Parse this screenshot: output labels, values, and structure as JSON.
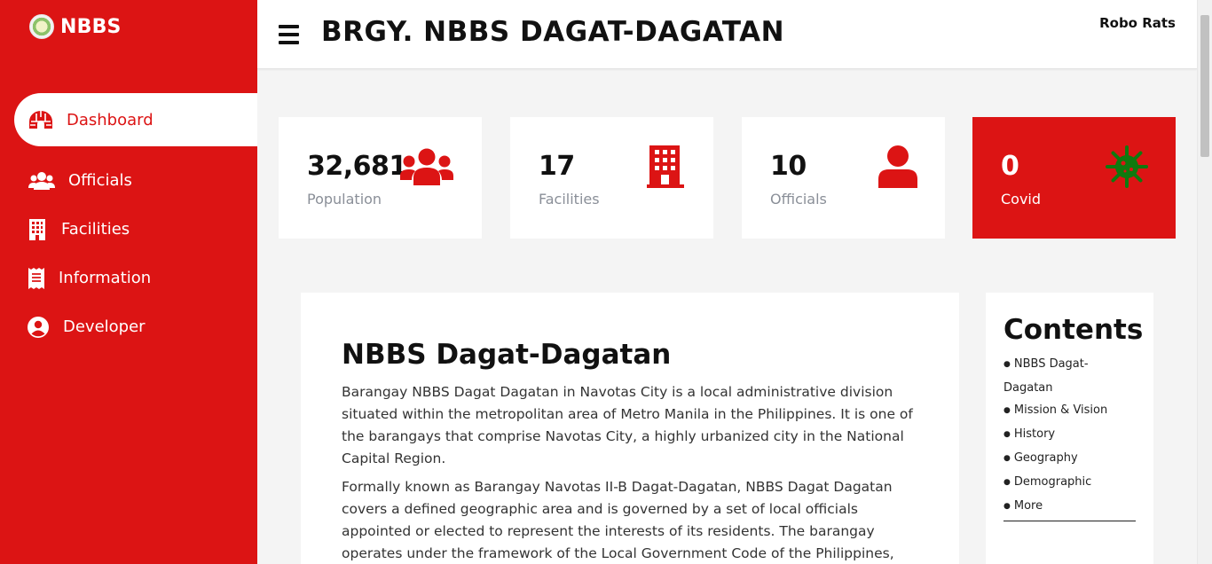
{
  "sidebar": {
    "brand": "NBBS",
    "items": [
      {
        "label": "Dashboard",
        "icon": "igloo-icon",
        "active": true
      },
      {
        "label": "Officials",
        "icon": "users-icon"
      },
      {
        "label": "Facilities",
        "icon": "building-icon"
      },
      {
        "label": "Information",
        "icon": "receipt-icon"
      },
      {
        "label": "Developer",
        "icon": "user-circle-icon"
      }
    ]
  },
  "header": {
    "title": "BRGY. NBBS DAGAT-DAGATAN",
    "user": "Robo Rats"
  },
  "stats": [
    {
      "value": "32,681",
      "label": "Population",
      "icon": "users-icon"
    },
    {
      "value": "17",
      "label": "Facilities",
      "icon": "building-icon"
    },
    {
      "value": "10",
      "label": "Officials",
      "icon": "user-icon"
    },
    {
      "value": "0",
      "label": "Covid",
      "icon": "virus-icon"
    }
  ],
  "article": {
    "title": "NBBS Dagat-Dagatan",
    "paragraphs": [
      "Barangay NBBS Dagat Dagatan in Navotas City is a local administrative division situated within the metropolitan area of Metro Manila in the Philippines. It is one of the barangays that comprise Navotas City, a highly urbanized city in the National Capital Region.",
      "Formally known as Barangay Navotas II-B Dagat-Dagatan, NBBS Dagat Dagatan covers a defined geographic area and is governed by a set of local officials appointed or elected to represent the interests of its residents. The barangay operates under the framework of the Local Government Code of the Philippines,"
    ]
  },
  "contents": {
    "title": "Contents",
    "items": [
      "NBBS Dagat-Dagatan",
      "Mission & Vision",
      "History",
      "Geography",
      "Demographic",
      "More"
    ]
  },
  "colors": {
    "primary": "#dc1414",
    "covid_icon": "#0f7a0f",
    "muted_text": "#8a8f98"
  }
}
